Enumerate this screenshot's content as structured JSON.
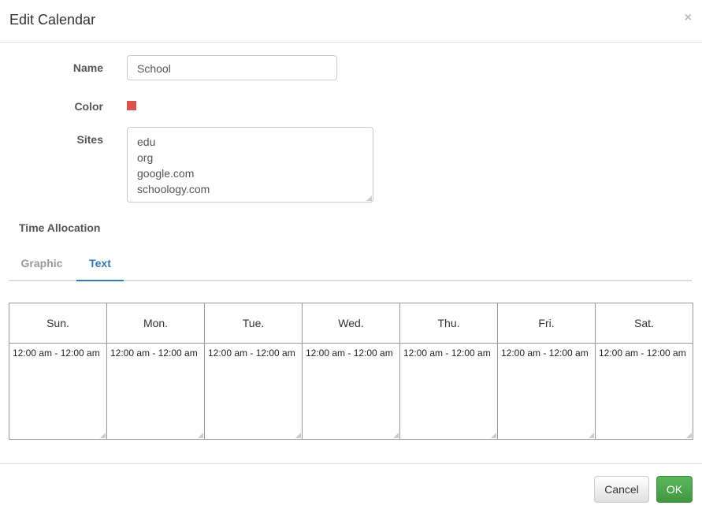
{
  "dialog": {
    "title": "Edit Calendar",
    "close_icon": "close-icon"
  },
  "form": {
    "name_label": "Name",
    "name_value": "School",
    "color_label": "Color",
    "color_value": "#d9534f",
    "sites_label": "Sites",
    "sites": [
      "edu",
      "org",
      "google.com",
      "schoology.com"
    ]
  },
  "time_allocation": {
    "label": "Time Allocation",
    "tabs": [
      {
        "label": "Graphic",
        "active": false
      },
      {
        "label": "Text",
        "active": true
      }
    ],
    "days": [
      {
        "name": "Sun.",
        "range": "12:00 am - 12:00 am"
      },
      {
        "name": "Mon.",
        "range": "12:00 am - 12:00 am"
      },
      {
        "name": "Tue.",
        "range": "12:00 am - 12:00 am"
      },
      {
        "name": "Wed.",
        "range": "12:00 am - 12:00 am"
      },
      {
        "name": "Thu.",
        "range": "12:00 am - 12:00 am"
      },
      {
        "name": "Fri.",
        "range": "12:00 am - 12:00 am"
      },
      {
        "name": "Sat.",
        "range": "12:00 am - 12:00 am"
      }
    ]
  },
  "footer": {
    "cancel_label": "Cancel",
    "ok_label": "OK"
  }
}
